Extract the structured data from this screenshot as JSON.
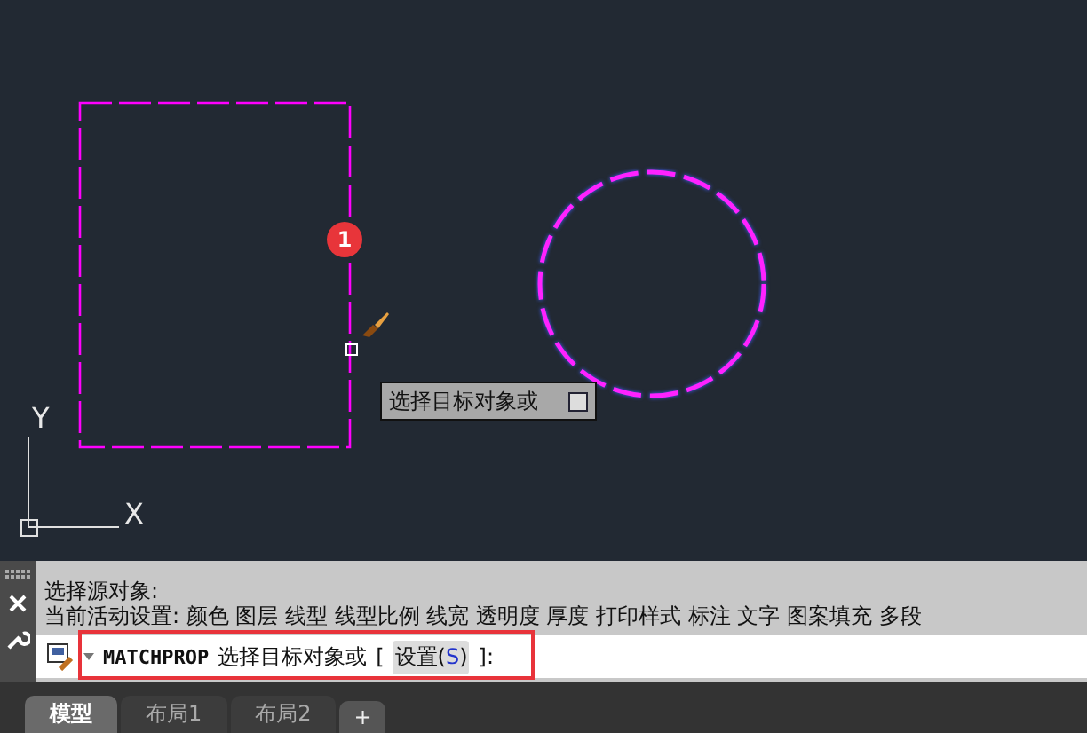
{
  "canvas": {
    "step_badge": "1",
    "tooltip": {
      "text": "选择目标对象或"
    },
    "ucs": {
      "x_label": "X",
      "y_label": "Y"
    }
  },
  "command_line": {
    "history": [
      "选择源对象:",
      "当前活动设置:  颜色 图层 线型 线型比例 线宽 透明度 厚度 打印样式 标注 文字 图案填充 多段"
    ],
    "input": {
      "command": "MATCHPROP",
      "prompt": "选择目标对象或",
      "bracket_open": "[",
      "option": {
        "before": "设置(",
        "key": "S",
        "after": ")"
      },
      "bracket_close": "]:",
      "highlighted": true
    }
  },
  "layout_tabs": [
    {
      "label": "模型",
      "selected": true
    },
    {
      "label": "布局1",
      "selected": false
    },
    {
      "label": "布局2",
      "selected": false
    }
  ],
  "add_tab": "+"
}
